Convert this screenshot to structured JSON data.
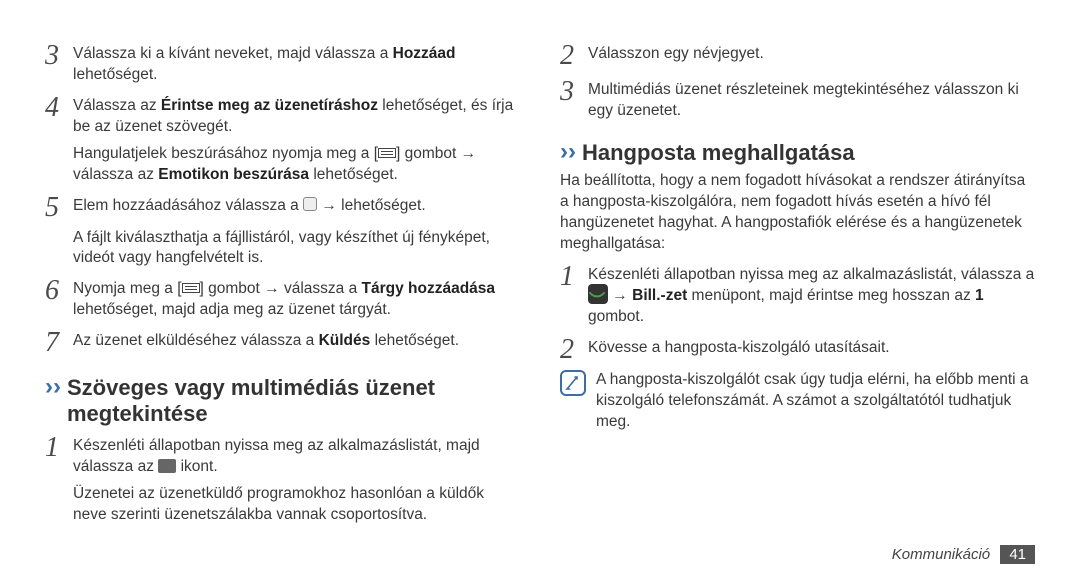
{
  "left": {
    "s3a": "Válassza ki a kívánt neveket, majd válassza a ",
    "s3b": "Hozzáad",
    "s3c": " lehetőséget.",
    "s4a": "Válassza az ",
    "s4b": "Érintse meg az üzenetíráshoz",
    "s4c": " lehetőséget, és írja be az üzenet szövegét.",
    "s4d": "Hangulatjelek beszúrásához nyomja meg a [",
    "s4e": "] gombot → válassza az ",
    "s4f": "Emotikon beszúrása",
    "s4g": " lehetőséget.",
    "s5a": "Elem hozzáadásához válassza a ",
    "s5b": " → lehetőséget.",
    "s5c": "A fájlt kiválaszthatja a fájllistáról, vagy készíthet új fényképet, videót vagy hangfelvételt is.",
    "s6a": "Nyomja meg a [",
    "s6b": "] gombot → válassza a ",
    "s6c": "Tárgy hozzáadása",
    "s6d": " lehetőséget, majd adja meg az üzenet tárgyát.",
    "s7a": "Az üzenet elküldéséhez válassza a ",
    "s7b": "Küldés",
    "s7c": " lehetőséget.",
    "secA": "Szöveges vagy multimédiás üzenet megtekintése",
    "a1a": "Készenléti állapotban nyissa meg az alkalmazáslistát, majd válassza az ",
    "a1b": " ikont.",
    "a1c": "Üzenetei az üzenetküldő programokhoz hasonlóan a küldők neve szerinti üzenetszálakba vannak csoportosítva."
  },
  "right": {
    "s2": "Válasszon egy névjegyet.",
    "s3": "Multimédiás üzenet részleteinek megtekintéséhez válasszon ki egy üzenetet.",
    "secB": "Hangposta meghallgatása",
    "intro": "Ha beállította, hogy a nem fogadott hívásokat a rendszer átirányítsa a hangposta-kiszolgálóra, nem fogadott hívás esetén a hívó fél hangüzenetet hagyhat. A hangpostafiók elérése és a hangüzenetek meghallgatása:",
    "b1a": "Készenléti állapotban nyissa meg az alkalmazáslistát, válassza a ",
    "b1b": " → ",
    "b1c": "Bill.-zet",
    "b1d": " menüpont, majd érintse meg hosszan az ",
    "b1e": "1",
    "b1f": " gombot.",
    "b2": "Kövesse a hangposta-kiszolgáló utasításait.",
    "note": "A hangposta-kiszolgálót csak úgy tudja elérni, ha előbb menti a kiszolgáló telefonszámát. A számot a szolgáltatótól tudhatjuk meg."
  },
  "footer": {
    "label": "Kommunikáció",
    "page": "41"
  }
}
